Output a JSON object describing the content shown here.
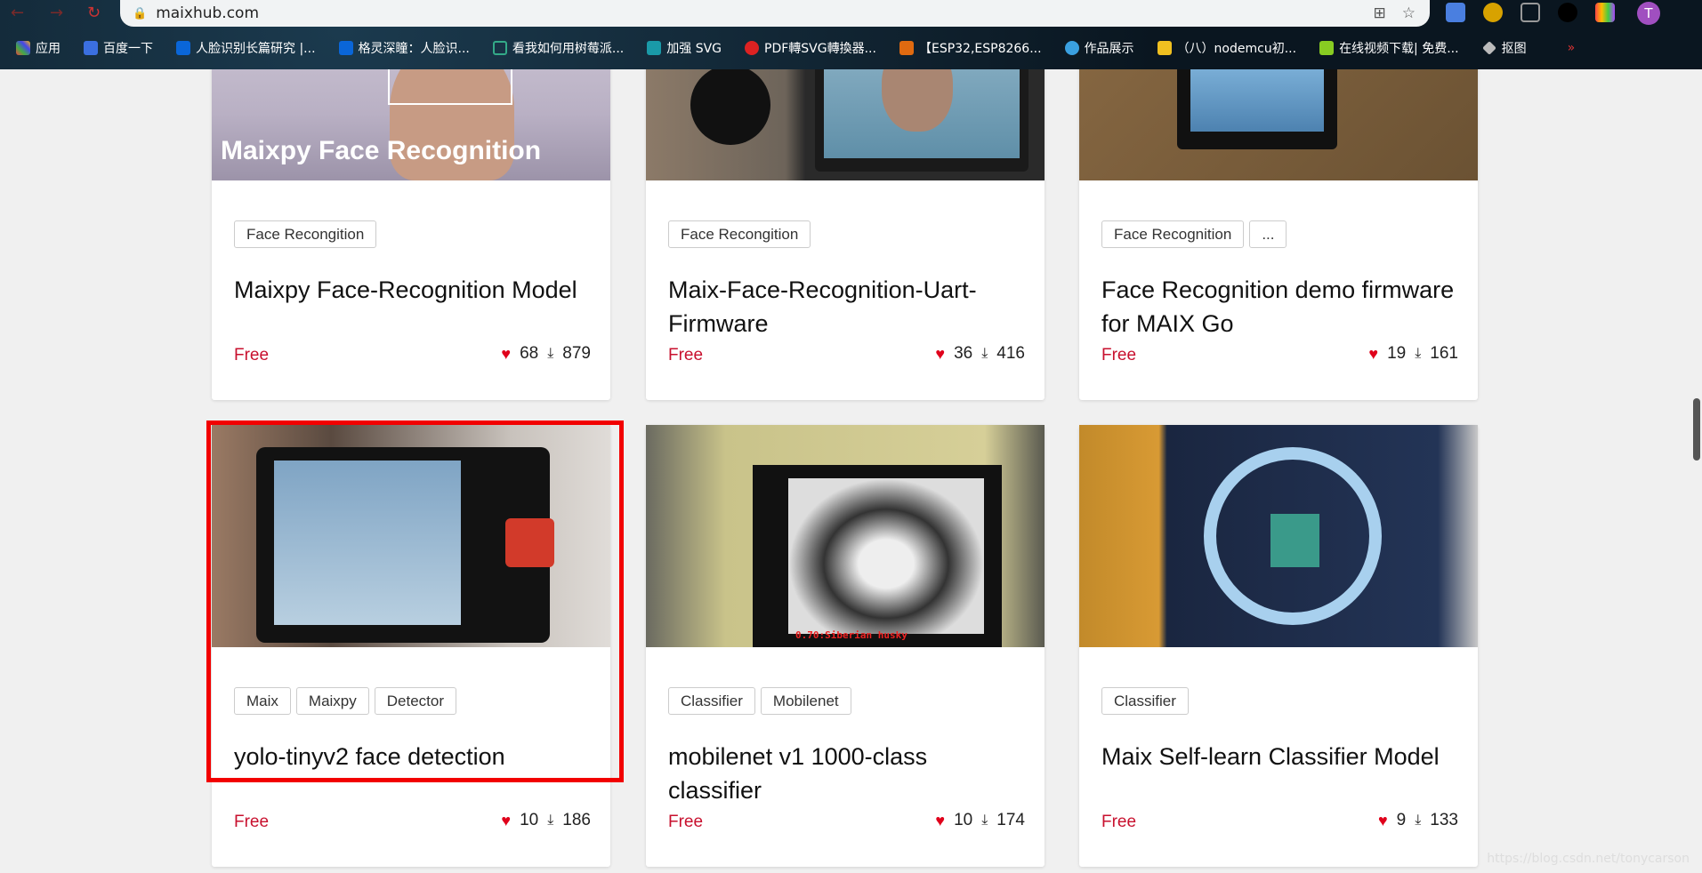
{
  "browser": {
    "url": "maixhub.com",
    "bookmarks": [
      "应用",
      "百度一下",
      "人脸识别长篇研究 |...",
      "格灵深瞳：人脸识...",
      "看我如何用树莓派...",
      "加强 SVG",
      "PDF轉SVG轉換器...",
      "【ESP32,ESP8266...",
      "作品展示",
      "（八）nodemcu初...",
      "在线视频下载| 免费...",
      "抠图"
    ],
    "avatar_letter": "T"
  },
  "cards": [
    {
      "tags": [
        "Face Recongition"
      ],
      "title": "Maixpy Face-Recognition Model",
      "price": "Free",
      "likes": "68",
      "downloads": "879",
      "image_text": "Maixpy Face Recognition"
    },
    {
      "tags": [
        "Face Recongition"
      ],
      "title": "Maix-Face-Recognition-Uart-Firmware",
      "price": "Free",
      "likes": "36",
      "downloads": "416"
    },
    {
      "tags": [
        "Face Recognition",
        "..."
      ],
      "title": "Face Recognition demo firmware for MAIX Go",
      "price": "Free",
      "likes": "19",
      "downloads": "161"
    },
    {
      "tags": [
        "Maix",
        "Maixpy",
        "Detector"
      ],
      "title": "yolo-tinyv2 face detection",
      "price": "Free",
      "likes": "10",
      "downloads": "186"
    },
    {
      "tags": [
        "Classifier",
        "Mobilenet"
      ],
      "title": "mobilenet v1 1000-class classifier",
      "price": "Free",
      "likes": "10",
      "downloads": "174",
      "image_text": "0.70:Siberian husky"
    },
    {
      "tags": [
        "Classifier"
      ],
      "title": "Maix Self-learn Classifier Model",
      "price": "Free",
      "likes": "9",
      "downloads": "133"
    }
  ],
  "watermark": "https://blog.csdn.net/tonycarson",
  "colors": {
    "highlight": "#f20000",
    "price": "#c8102e",
    "heart": "#e0001b"
  }
}
